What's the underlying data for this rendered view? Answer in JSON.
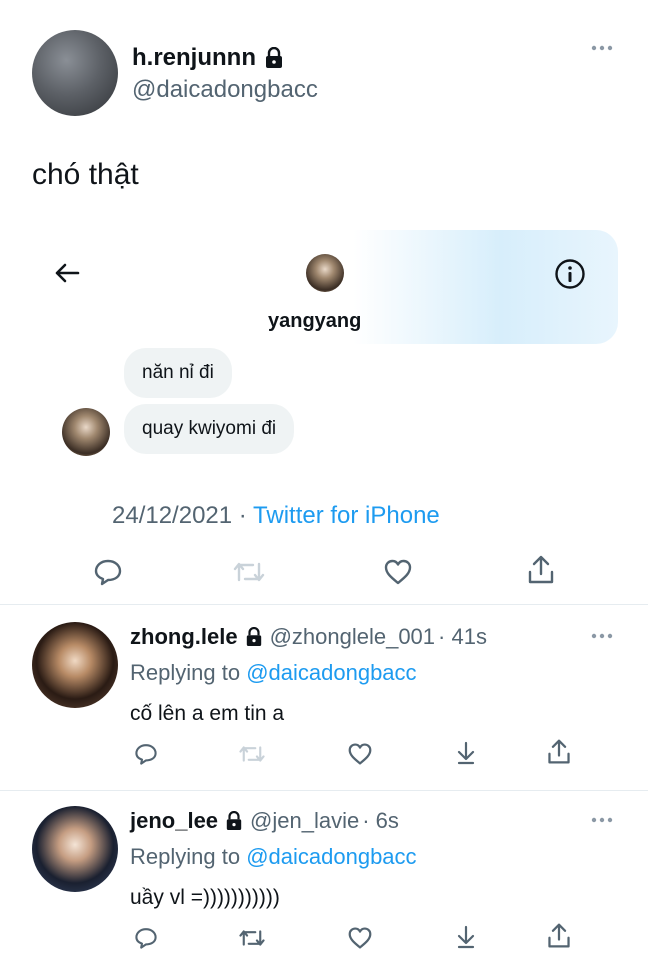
{
  "main_tweet": {
    "name": "h.renjunnn",
    "handle": "@daicadongbacc",
    "more_icon": "more-dots-icon",
    "text": "chó thật",
    "timestamp": "24/12/2021",
    "separator": "·",
    "source": "Twitter for iPhone"
  },
  "dm_card": {
    "back_icon": "back-arrow-icon",
    "info_icon": "info-icon",
    "contact_name": "yangyang",
    "messages": [
      {
        "text": "năn nỉ đi"
      },
      {
        "text": "quay kwiyomi đi"
      }
    ]
  },
  "actions": {
    "icons": [
      "reply-icon",
      "retweet-icon",
      "like-icon",
      "share-icon"
    ]
  },
  "replies": [
    {
      "name": "zhong.lele",
      "handle": "@zhonglele_001",
      "time": "· 41s",
      "replying_prefix": "Replying to",
      "replying_to": "@daicadongbacc",
      "text": "cố lên a em tin a"
    },
    {
      "name": "jeno_lee",
      "handle": "@jen_lavie",
      "time": "· 6s",
      "replying_prefix": "Replying to",
      "replying_to": "@daicadongbacc",
      "text": "uầy vl =)))))))))))"
    }
  ],
  "colors": {
    "accent": "#1d9bf0",
    "secondary_text": "#536471",
    "bubble_bg": "#eff3f4"
  }
}
